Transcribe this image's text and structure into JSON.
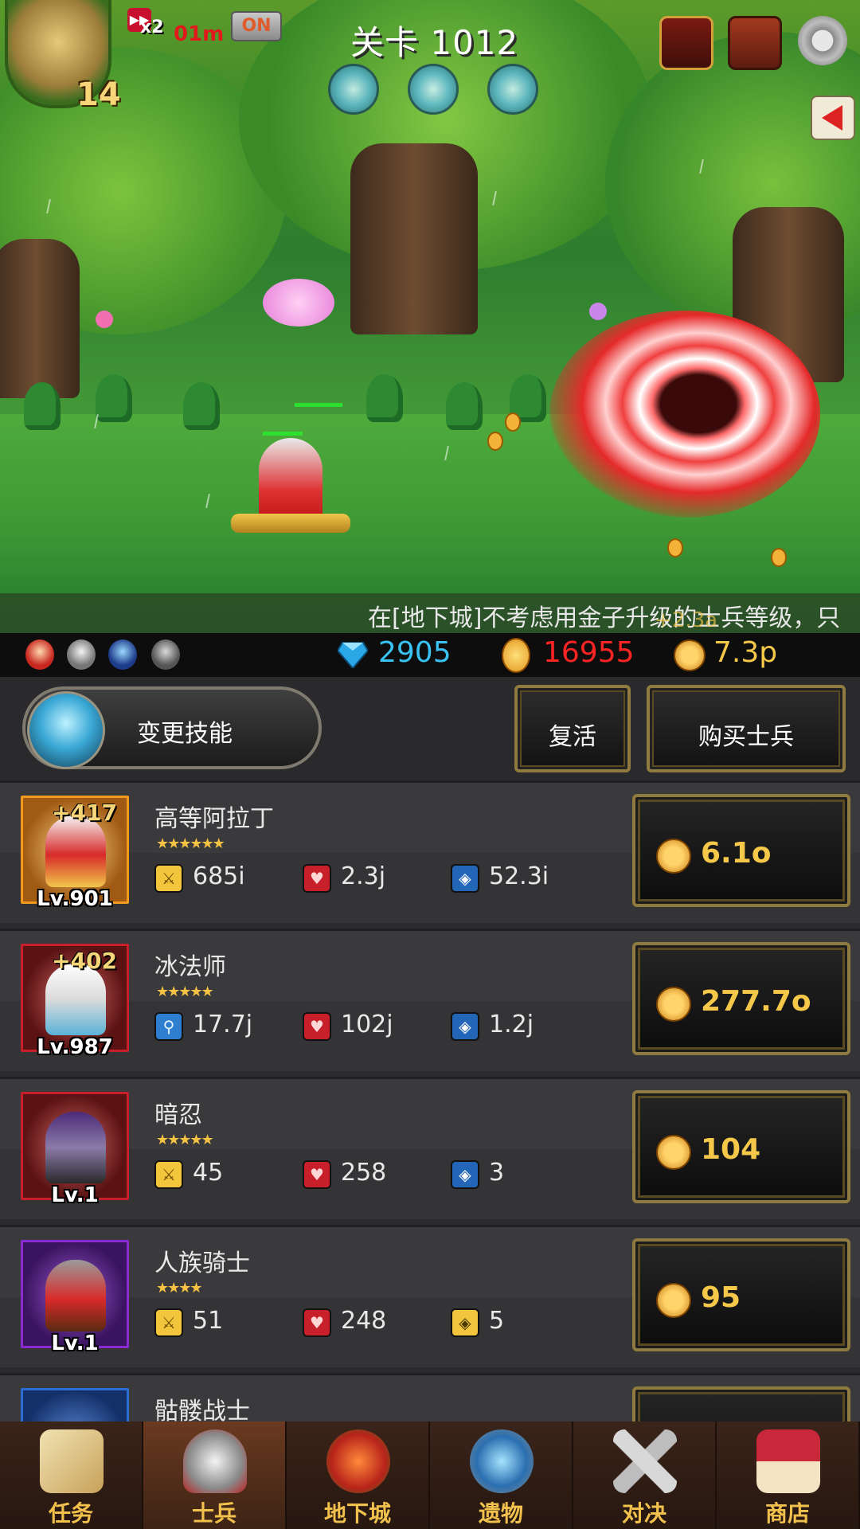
{
  "hud": {
    "hero_level": "14",
    "speed_multiplier": "x2",
    "speed_timer": "01m",
    "auto_toggle": "ON",
    "stage_title": "关卡 1012"
  },
  "ticker": {
    "message": "在[地下城]不考虑用金子升级的士兵等级，只",
    "floating_gain": "+2.3a"
  },
  "resources": {
    "gems": "2905",
    "medals": "16955",
    "gold": "7.3p"
  },
  "actions": {
    "change_skill": "变更技能",
    "revive": "复活",
    "buy_soldier": "购买士兵"
  },
  "soldiers": [
    {
      "name": "高等阿拉丁",
      "stars": "★★★★★★",
      "bonus": "+417",
      "level": "Lv.901",
      "stat1": "685i",
      "stat2": "2.3j",
      "stat3": "52.3i",
      "price": "6.1o"
    },
    {
      "name": "冰法师",
      "stars": "★★★★★",
      "bonus": "+402",
      "level": "Lv.987",
      "stat1": "17.7j",
      "stat2": "102j",
      "stat3": "1.2j",
      "price": "277.7o"
    },
    {
      "name": "暗忍",
      "stars": "★★★★★",
      "bonus": "",
      "level": "Lv.1",
      "stat1": "45",
      "stat2": "258",
      "stat3": "3",
      "price": "104"
    },
    {
      "name": "人族骑士",
      "stars": "★★★★",
      "bonus": "",
      "level": "Lv.1",
      "stat1": "51",
      "stat2": "248",
      "stat3": "5",
      "price": "95"
    },
    {
      "name": "骷髅战士",
      "stars": "",
      "bonus": "",
      "level": "",
      "stat1": "",
      "stat2": "",
      "stat3": "",
      "price": ""
    }
  ],
  "colors": {
    "gold_text": "#f5c84a",
    "gem_text": "#39c2f2",
    "medal_text": "#ff2424",
    "frame_gold": "#8f7a3f"
  },
  "nav": {
    "tabs": [
      "任务",
      "士兵",
      "地下城",
      "遗物",
      "对决",
      "商店"
    ],
    "active": "士兵"
  }
}
